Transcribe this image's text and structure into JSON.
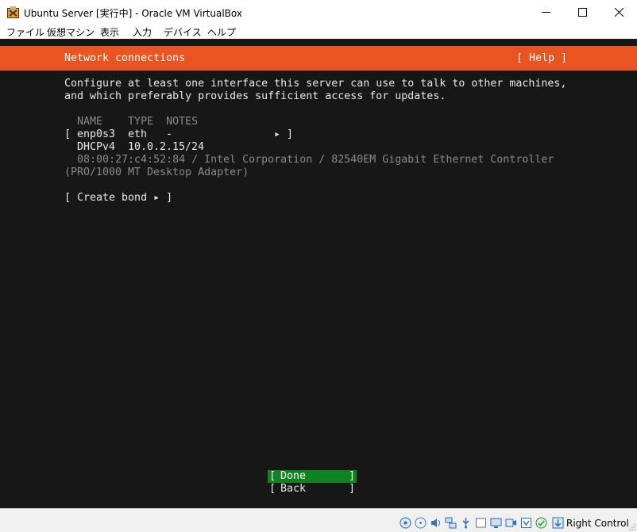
{
  "window": {
    "title": "Ubuntu Server [実行中] - Oracle VM VirtualBox"
  },
  "menu": {
    "items": [
      "ファイル",
      "仮想マシン",
      "表示",
      "入力",
      "デバイス",
      "ヘルプ"
    ]
  },
  "header": {
    "title": "Network connections",
    "help": "[ Help ]"
  },
  "intro": {
    "line1": "Configure at least one interface this server can use to talk to other machines,",
    "line2": "and which preferably provides sufficient access for updates."
  },
  "table": {
    "columns": "  NAME    TYPE  NOTES",
    "interface": {
      "bracket_open": "[",
      "name": "enp0s3",
      "type": "eth",
      "notes": "-",
      "arrow": "▸",
      "bracket_close": "]",
      "dhcp_label": "DHCPv4",
      "address": "10.0.2.15/24",
      "details_line1": "08:00:27:c4:52:84 / Intel Corporation / 82540EM Gigabit Ethernet Controller",
      "details_line2": "(PRO/1000 MT Desktop Adapter)"
    }
  },
  "actions": {
    "create_bond": "[ Create bond ▸ ]",
    "done_label": "Done",
    "back_label": "Back",
    "bracket_open": "[",
    "bracket_close": "]"
  },
  "status_bar": {
    "host_key": "Right Control",
    "icons": [
      "hard-disk-icon",
      "optical-drive-icon",
      "audio-icon",
      "network-icon",
      "usb-icon",
      "shared-folder-icon",
      "display-icon",
      "video-capture-icon",
      "mouse-integration-icon",
      "cpu-icon",
      "host-key-arrow-icon"
    ]
  },
  "colors": {
    "header": "#e95420",
    "screen_bg": "#171717",
    "done_button": "#0e8420"
  }
}
